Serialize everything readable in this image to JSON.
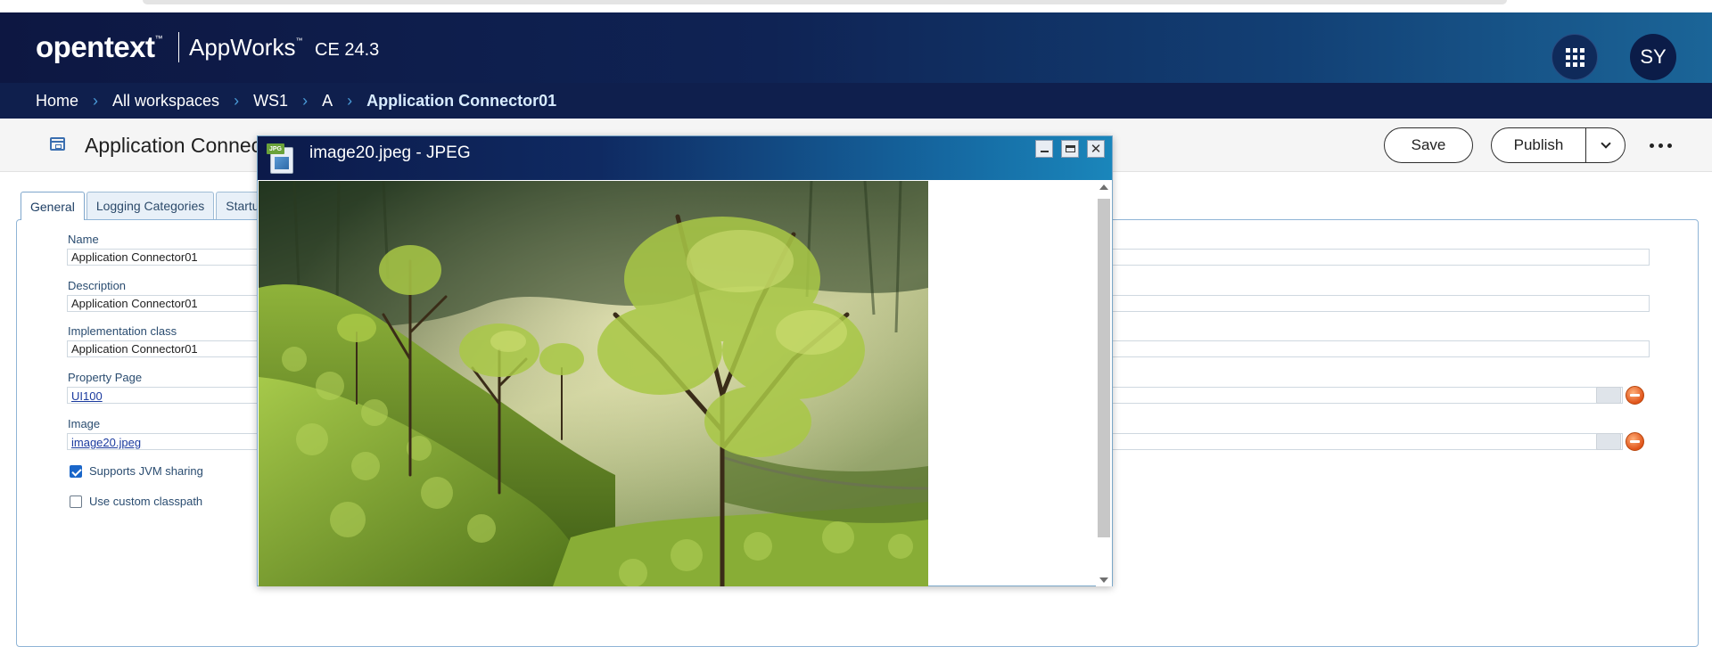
{
  "header": {
    "logo_text": "opentext",
    "logo_tm": "™",
    "product": "AppWorks",
    "product_tm": "™",
    "version": "CE  24.3",
    "avatar_initials": "SY"
  },
  "breadcrumb": [
    "Home",
    "All workspaces",
    "WS1",
    "A",
    "Application Connector01"
  ],
  "title_bar": {
    "title": "Application Connector01",
    "save_label": "Save",
    "publish_label": "Publish"
  },
  "tabs": [
    "General",
    "Logging Categories",
    "Startup"
  ],
  "form": {
    "name_label": "Name",
    "name_value": "Application Connector01",
    "description_label": "Description",
    "description_value": "Application Connector01",
    "impl_label": "Implementation class",
    "impl_value": "Application Connector01",
    "property_page_label": "Property Page",
    "property_page_value": "UI100",
    "image_label": "Image",
    "image_value": "image20.jpeg",
    "jvm_sharing_label": "Supports JVM sharing",
    "jvm_sharing_checked": true,
    "custom_classpath_label": "Use custom classpath",
    "custom_classpath_checked": false
  },
  "viewer": {
    "title": "image20.jpeg - JPEG",
    "file_badge": "JPG",
    "image_description": "sunlit tea plantation hillside with trees"
  },
  "colors": {
    "header_dark": "#0d1742",
    "header_light": "#1b6598",
    "breadcrumb_bg": "#0f1f4d",
    "breadcrumb_sep": "#4a9bd8",
    "tab_border": "#9fbcd6",
    "remove_orange": "#e0541a",
    "checkbox_blue": "#1a66c9"
  }
}
